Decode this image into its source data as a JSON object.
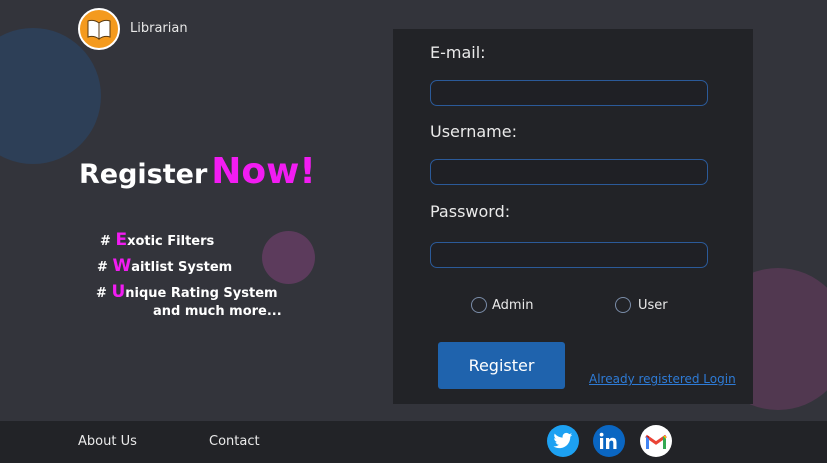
{
  "brand": {
    "name": "Librarian",
    "icon": "book-icon"
  },
  "hero": {
    "title_prefix": "Register",
    "title_emphasis": "Now!",
    "features": [
      {
        "hash": "#",
        "first": "E",
        "rest": "xotic Filters"
      },
      {
        "hash": "#",
        "first": "W",
        "rest": "aitlist System"
      },
      {
        "hash": "#",
        "first": "U",
        "rest": "nique Rating System"
      }
    ],
    "more": "and much more..."
  },
  "form": {
    "email_label": "E-mail:",
    "email_value": "",
    "username_label": "Username:",
    "username_value": "",
    "password_label": "Password:",
    "password_value": "",
    "role_options": [
      "Admin",
      "User"
    ],
    "register_button": "Register",
    "login_link": "Already registered Login"
  },
  "footer": {
    "about": "About Us",
    "contact": "Contact",
    "social": [
      "twitter-icon",
      "linkedin-icon",
      "gmail-icon"
    ]
  },
  "colors": {
    "accent": "#f21cf2",
    "primary_button": "#1f63ad",
    "link": "#2e7bd6",
    "background": "#33343b",
    "panel": "#222327"
  }
}
